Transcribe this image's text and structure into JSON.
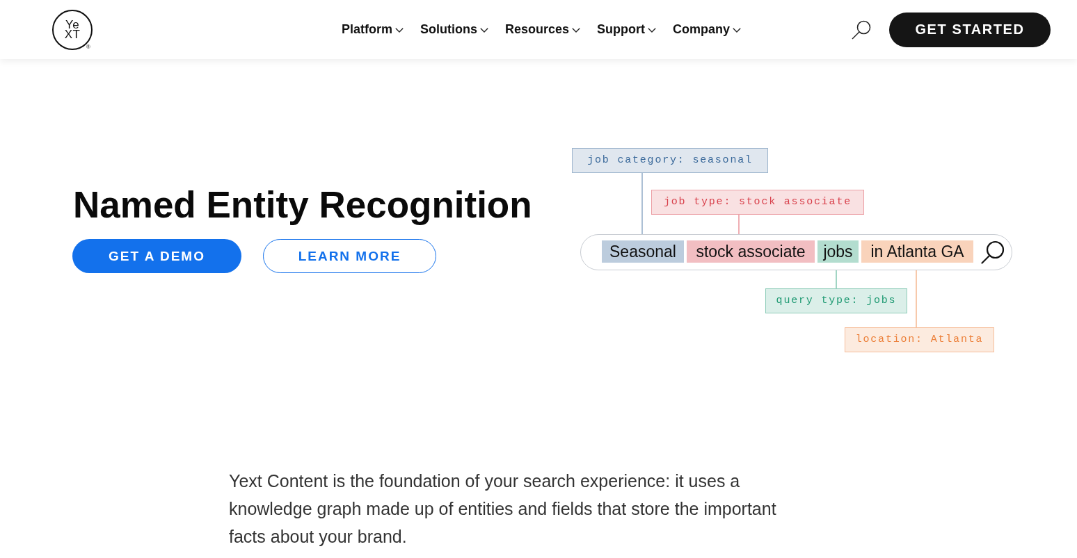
{
  "header": {
    "logo": {
      "top": "Ye",
      "bottom": "XT",
      "mark": "®"
    },
    "nav": [
      {
        "label": "Platform"
      },
      {
        "label": "Solutions"
      },
      {
        "label": "Resources"
      },
      {
        "label": "Support"
      },
      {
        "label": "Company"
      }
    ],
    "cta": "GET STARTED"
  },
  "hero": {
    "title": "Named Entity Recognition",
    "buttons": [
      {
        "label": "GET A DEMO",
        "kind": "primary"
      },
      {
        "label": "LEARN MORE",
        "kind": "outline"
      }
    ]
  },
  "illustration": {
    "entities": [
      {
        "tag": "job category: seasonal",
        "phrase": "Seasonal",
        "color": "#3b6a9b"
      },
      {
        "tag": "job type: stock associate",
        "phrase": "stock associate",
        "color": "#d8414c"
      },
      {
        "tag": "query type: jobs",
        "phrase": "jobs",
        "color": "#1f9a73"
      },
      {
        "tag": "location: Atlanta",
        "phrase": "in Atlanta GA",
        "color": "#ec7f38"
      }
    ]
  },
  "intro": "Yext Content is the foundation of your search experience: it uses a knowledge graph made up of entities and fields that store the important facts about your brand."
}
